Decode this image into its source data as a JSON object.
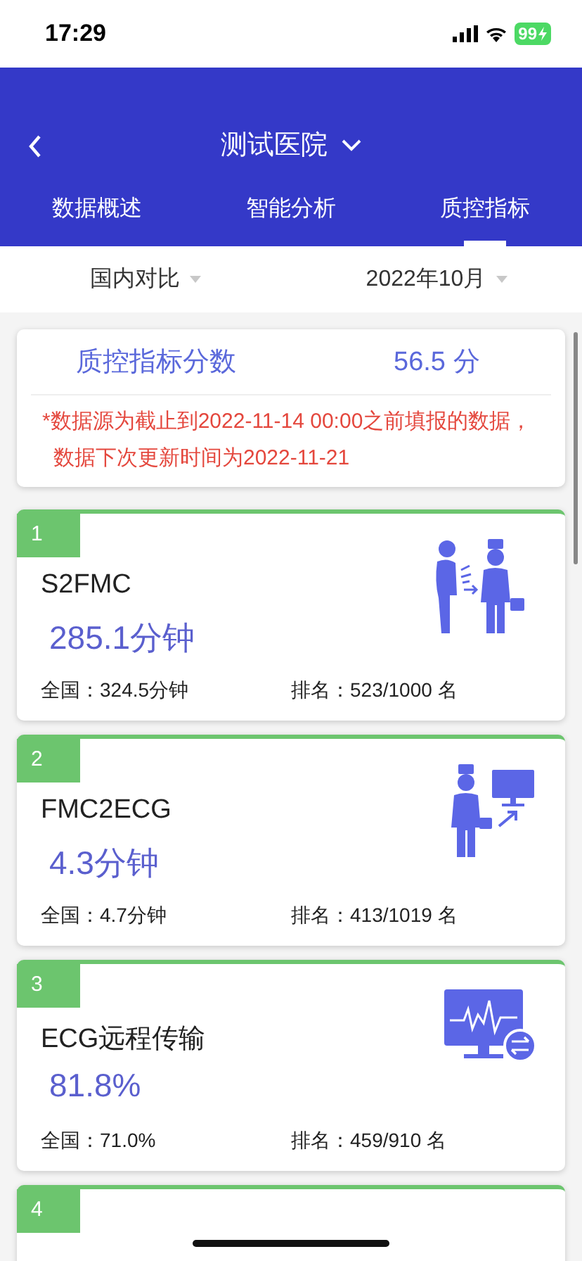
{
  "status_bar": {
    "time": "17:29",
    "battery": "99"
  },
  "header": {
    "title": "测试医院"
  },
  "tabs": [
    {
      "label": "数据概述",
      "selected": false
    },
    {
      "label": "智能分析",
      "selected": false
    },
    {
      "label": "质控指标",
      "selected": true
    }
  ],
  "filters": [
    {
      "label": "国内对比"
    },
    {
      "label": "2022年10月"
    }
  ],
  "summary": {
    "label": "质控指标分数",
    "score": "56.5 分",
    "note": "*数据源为截止到2022-11-14 00:00之前填报的数据，数据下次更新时间为2022-11-21"
  },
  "metrics": [
    {
      "index": "1",
      "name": "S2FMC",
      "value": "285.1分钟",
      "national": "全国：324.5分钟",
      "rank": "排名：523/1000 名",
      "kind": "patient-doctor"
    },
    {
      "index": "2",
      "name": "FMC2ECG",
      "value": "4.3分钟",
      "national": "全国：4.7分钟",
      "rank": "排名：413/1019 名",
      "kind": "doctor-monitor"
    },
    {
      "index": "3",
      "name": "ECG远程传输",
      "value": "81.8%",
      "national": "全国：71.0%",
      "rank": "排名：459/910 名",
      "kind": "monitor-transfer"
    },
    {
      "index": "4"
    }
  ]
}
